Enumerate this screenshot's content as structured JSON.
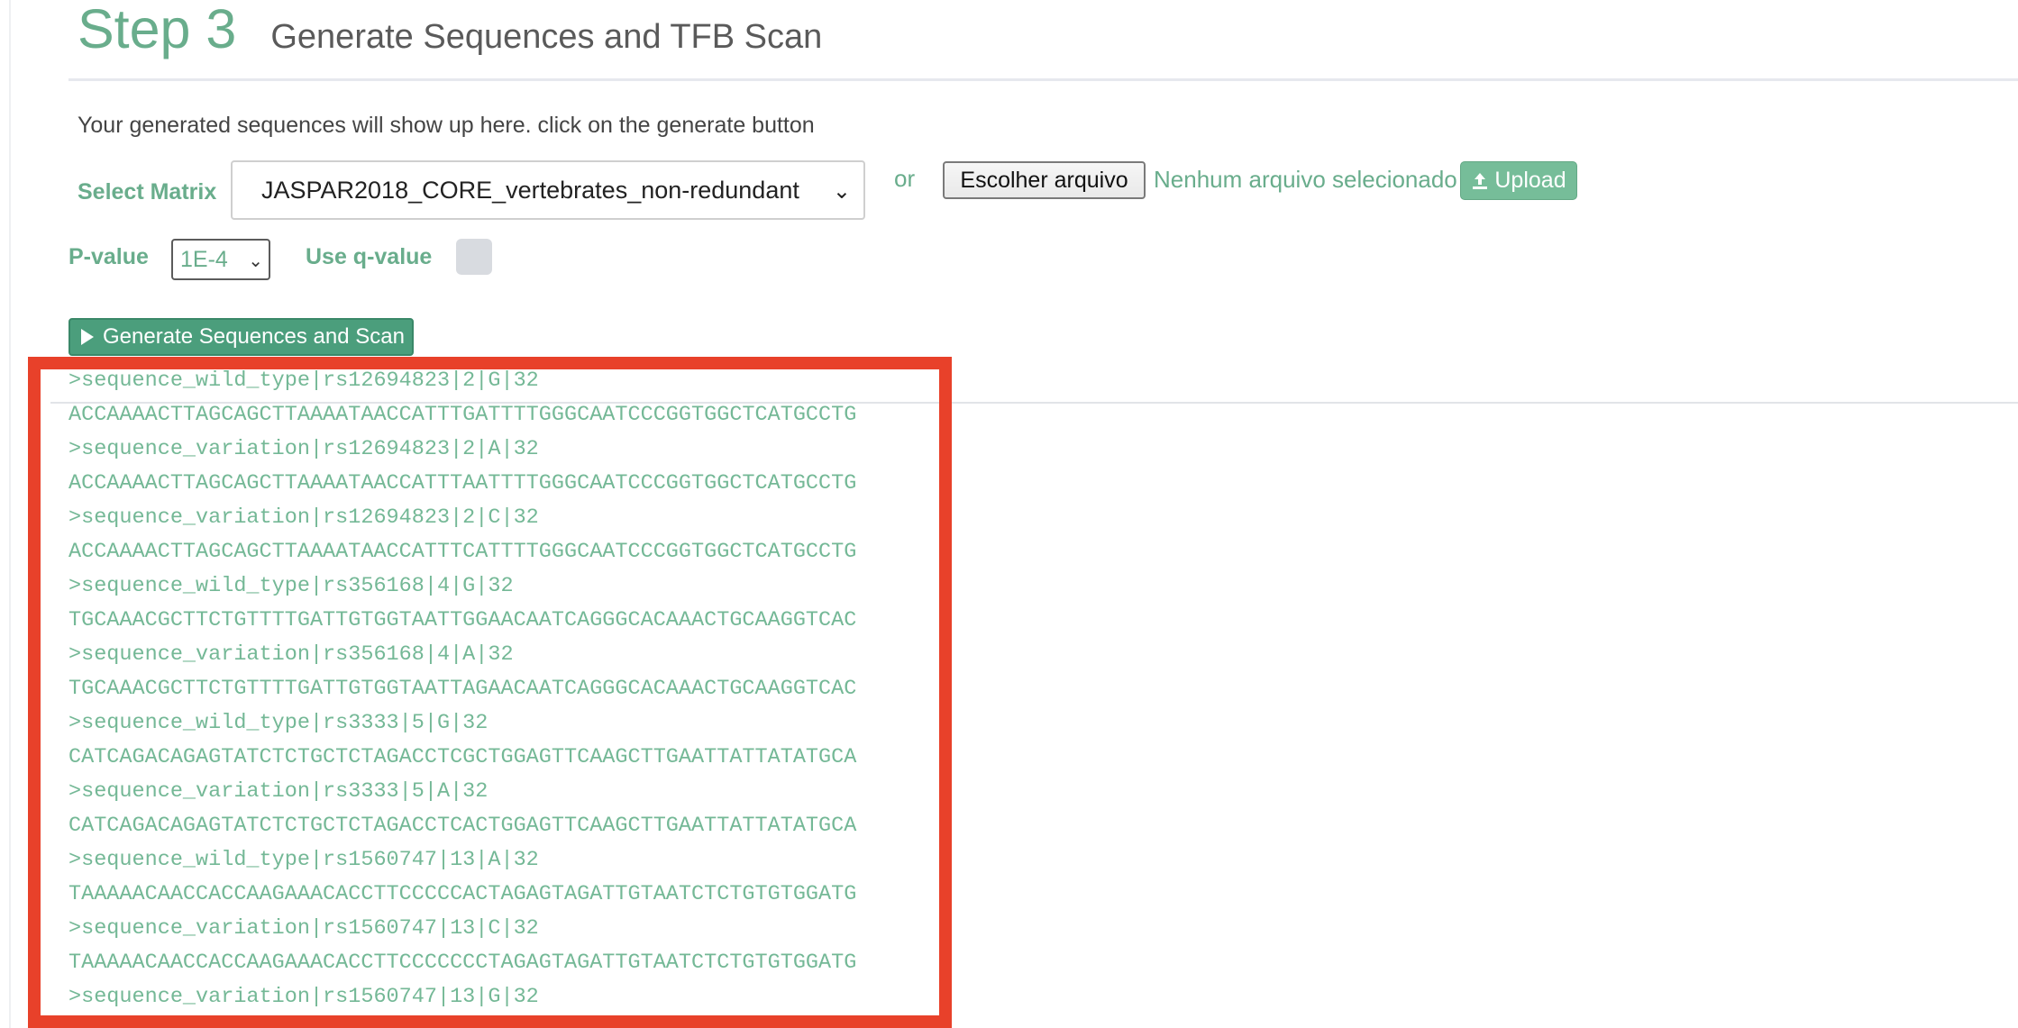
{
  "header": {
    "step": "Step 3",
    "title": "Generate Sequences and TFB Scan"
  },
  "intro_text": "Your generated sequences will show up here. click on the generate button",
  "matrix": {
    "label": "Select Matrix",
    "selected": "JASPAR2018_CORE_vertebrates_non-redundant",
    "or_text": "or",
    "file_button": "Escolher arquivo",
    "file_status": "Nenhum arquivo selecionado",
    "upload_button": "Upload"
  },
  "pvalue": {
    "label": "P-value",
    "selected": "1E-4"
  },
  "qvalue": {
    "label": "Use q-value",
    "checked": false
  },
  "generate_button": "Generate Sequences and Scan",
  "sequences": [
    ">sequence_wild_type|rs12694823|2|G|32",
    "ACCAAAACTTAGCAGCTTAAAATAACCATTTGATTTTGGGCAATCCCGGTGGCTCATGCCTG",
    ">sequence_variation|rs12694823|2|A|32",
    "ACCAAAACTTAGCAGCTTAAAATAACCATTTAATTTTGGGCAATCCCGGTGGCTCATGCCTG",
    ">sequence_variation|rs12694823|2|C|32",
    "ACCAAAACTTAGCAGCTTAAAATAACCATTTCATTTTGGGCAATCCCGGTGGCTCATGCCTG",
    ">sequence_wild_type|rs356168|4|G|32",
    "TGCAAACGCTTCTGTTTTGATTGTGGTAATTGGAACAATCAGGGCACAAACTGCAAGGTCAC",
    ">sequence_variation|rs356168|4|A|32",
    "TGCAAACGCTTCTGTTTTGATTGTGGTAATTAGAACAATCAGGGCACAAACTGCAAGGTCAC",
    ">sequence_wild_type|rs3333|5|G|32",
    "CATCAGACAGAGTATCTCTGCTCTAGACCTCGCTGGAGTTCAAGCTTGAATTATTATATGCA",
    ">sequence_variation|rs3333|5|A|32",
    "CATCAGACAGAGTATCTCTGCTCTAGACCTCACTGGAGTTCAAGCTTGAATTATTATATGCA",
    ">sequence_wild_type|rs1560747|13|A|32",
    "TAAAAACAACCACCAAGAAACACCTTCCCCCACTAGAGTAGATTGTAATCTCTGTGTGGATG",
    ">sequence_variation|rs1560747|13|C|32",
    "TAAAAACAACCACCAAGAAACACCTTCCCCCCCTAGAGTAGATTGTAATCTCTGTGTGGATG",
    ">sequence_variation|rs1560747|13|G|32"
  ],
  "colors": {
    "accent": "#69ad8c",
    "button": "#4b9e7c",
    "highlight": "#e8412a"
  }
}
